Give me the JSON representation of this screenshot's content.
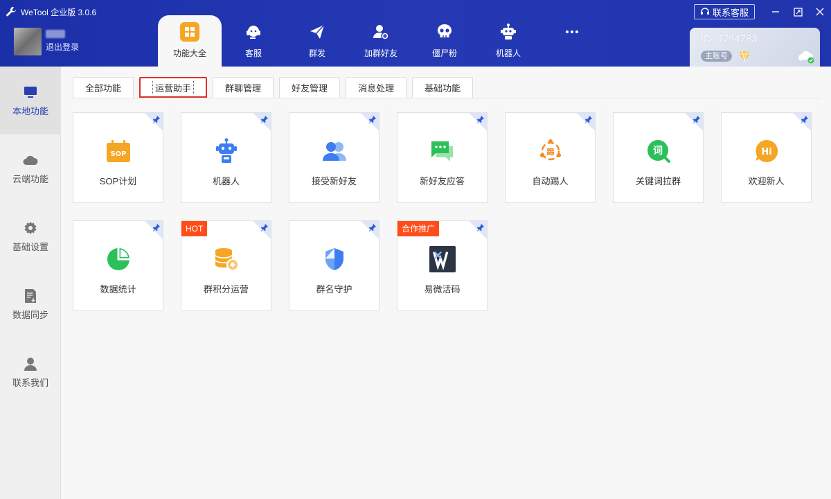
{
  "app": {
    "title": "WeTool 企业版 3.0.6",
    "user_logout": "退出登录",
    "service_btn": "联系客服"
  },
  "nav": [
    {
      "label": "功能大全",
      "icon": "grid-icon"
    },
    {
      "label": "客服",
      "icon": "headset-icon"
    },
    {
      "label": "群发",
      "icon": "send-icon"
    },
    {
      "label": "加群好友",
      "icon": "add-user-icon"
    },
    {
      "label": "僵尸粉",
      "icon": "skull-icon"
    },
    {
      "label": "机器人",
      "icon": "robot-icon"
    },
    {
      "label": "",
      "icon": "more-icon"
    }
  ],
  "account": {
    "id": "ID: 4794783",
    "tag": "主账号"
  },
  "sidebar": [
    {
      "label": "本地功能",
      "icon": "monitor-icon"
    },
    {
      "label": "云端功能",
      "icon": "cloud-icon"
    },
    {
      "label": "基础设置",
      "icon": "gear-icon"
    },
    {
      "label": "数据同步",
      "icon": "sync-icon"
    },
    {
      "label": "联系我们",
      "icon": "person-icon"
    }
  ],
  "tabs": [
    "全部功能",
    "运营助手",
    "群聊管理",
    "好友管理",
    "消息处理",
    "基础功能"
  ],
  "cards": [
    {
      "label": "SOP计划",
      "icon": "sop-icon",
      "badge": ""
    },
    {
      "label": "机器人",
      "icon": "robot-icon",
      "badge": ""
    },
    {
      "label": "接受新好友",
      "icon": "users-icon",
      "badge": ""
    },
    {
      "label": "新好友应答",
      "icon": "chat-icon",
      "badge": ""
    },
    {
      "label": "自动踢人",
      "icon": "kick-icon",
      "badge": ""
    },
    {
      "label": "关键词拉群",
      "icon": "keyword-icon",
      "badge": ""
    },
    {
      "label": "欢迎新人",
      "icon": "welcome-icon",
      "badge": ""
    },
    {
      "label": "数据统计",
      "icon": "pie-chart-icon",
      "badge": ""
    },
    {
      "label": "群积分运营",
      "icon": "coins-icon",
      "badge": "HOT"
    },
    {
      "label": "群名守护",
      "icon": "shield-icon",
      "badge": ""
    },
    {
      "label": "易微活码",
      "icon": "ew-logo-icon",
      "badge": "合作推广"
    }
  ],
  "colors": {
    "header": "#1f34ad",
    "accent": "#2b3fb3",
    "orange": "#f5a623",
    "badge": "#ff4d1a",
    "active_tab_border": "#d9302f"
  }
}
